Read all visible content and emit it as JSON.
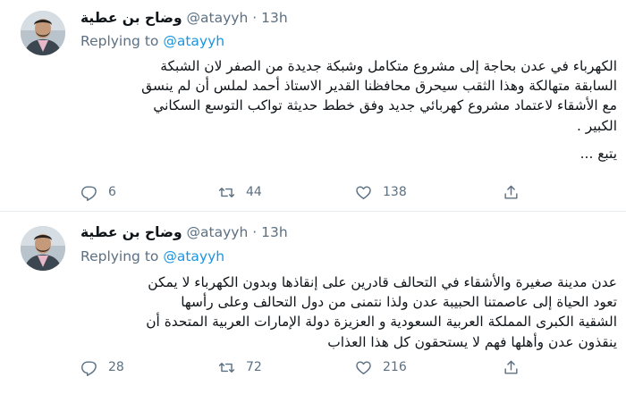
{
  "tweets": [
    {
      "author_name": "وضاح بن عطية",
      "handle": "@atayyh",
      "separator": "·",
      "time": "13h",
      "replying_prefix": "Replying to",
      "replying_to": "@atayyh",
      "lines": [
        "الكهرباء في عدن بحاجة إلى مشروع متكامل وشبكة جديدة من الصفر لان الشبكة",
        "السابقة متهالكة وهذا الثقب سيحرق محافظنا القدير الاستاذ أحمد لملس أن لم ينسق",
        "مع الأشقاء لاعتماد مشروع كهربائي جديد وفق خطط حديثة تواكب التوسع السكاني",
        "الكبير ."
      ],
      "continuation": "يتبع ...",
      "counts": {
        "replies": "6",
        "retweets": "44",
        "likes": "138"
      }
    },
    {
      "author_name": "وضاح بن عطية",
      "handle": "@atayyh",
      "separator": "·",
      "time": "13h",
      "replying_prefix": "Replying to",
      "replying_to": "@atayyh",
      "lines": [
        "عدن مدينة صغيرة والأشقاء في التحالف قادرين على إنقاذها وبدون الكهرباء لا يمكن",
        "تعود الحياة إلى عاصمتنا الحبيبة عدن ولذا نتمنى من دول التحالف وعلى رأسها",
        "الشقية الكبرى المملكة العربية السعودية و العزيزة دولة الإمارات العربية المتحدة أن",
        "ينقذون عدن وأهلها فهم لا يستحقون كل هذا العذاب"
      ],
      "counts": {
        "replies": "28",
        "retweets": "72",
        "likes": "216"
      }
    }
  ],
  "icons": {
    "reply": "comment-bubble",
    "retweet": "retweet-arrows",
    "like": "heart",
    "share": "share-upload-arrow"
  },
  "colors": {
    "link": "#1b95e0",
    "secondary_text": "#5b7083",
    "primary_text": "#0f1419",
    "divider": "#e6ecf0",
    "avatar_shirt": "#e8b7c7"
  }
}
